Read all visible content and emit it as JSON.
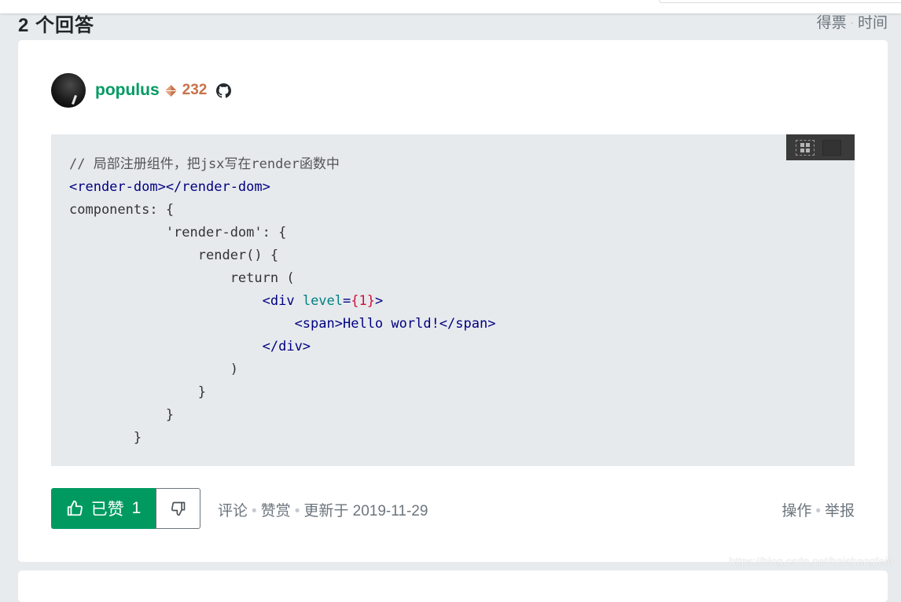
{
  "answers": {
    "count_label": "2 个回答",
    "sort": [
      "得票",
      "时间"
    ]
  },
  "answer": {
    "author": {
      "name": "populus",
      "reputation": "232"
    },
    "code": {
      "lines": [
        "// 局部注册组件，把jsx写在render函数中",
        "<render-dom></render-dom>",
        "components: {",
        "            'render-dom': {",
        "                render() {",
        "                    return (",
        "                        <div level={1}>",
        "                            <span>Hello world!</span>",
        "                        </div>",
        "                    )",
        "                }",
        "            }",
        "        }"
      ]
    },
    "vote": {
      "liked_label": "已赞",
      "liked_count": "1"
    },
    "meta": {
      "comment": "评论",
      "reward": "赞赏",
      "updated": "更新于 2019-11-29",
      "actions": "操作",
      "report": "举报"
    }
  },
  "watermark": "https://blog.csdn.net/haishangfeie",
  "colors": {
    "brand_green": "#009a61",
    "rep_orange": "#c8734a",
    "code_bg": "#e7eaed"
  }
}
